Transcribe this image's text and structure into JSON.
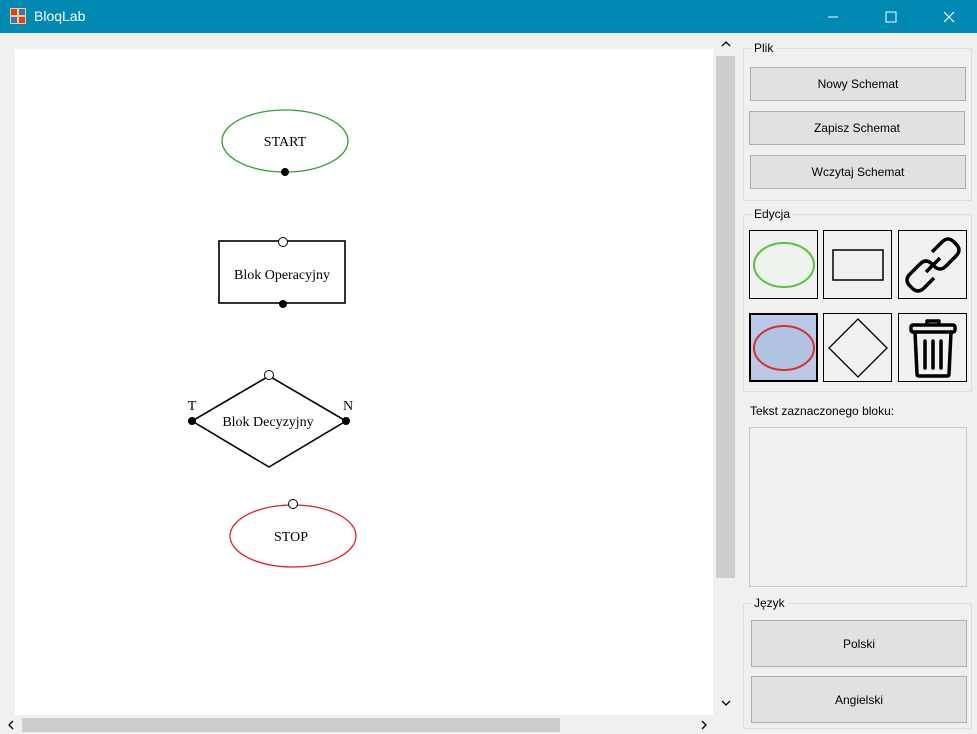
{
  "window": {
    "title": "BloqLab",
    "controls": [
      "minimize",
      "maximize",
      "close"
    ]
  },
  "diagram": {
    "blocks": [
      {
        "type": "start",
        "label": "START",
        "color": "#2e9e2e"
      },
      {
        "type": "operation",
        "label": "Blok Operacyjny",
        "color": "#000000"
      },
      {
        "type": "decision",
        "label": "Blok Decyzyjny",
        "true_label": "T",
        "false_label": "N",
        "color": "#000000"
      },
      {
        "type": "stop",
        "label": "STOP",
        "color": "#e02020"
      }
    ]
  },
  "panel": {
    "file_group": {
      "title": "Plik",
      "buttons": [
        "Nowy Schemat",
        "Zapisz Schemat",
        "Wczytaj Schemat"
      ]
    },
    "edit_group": {
      "title": "Edycja",
      "tools": [
        {
          "icon": "start-ellipse-icon",
          "selected": false
        },
        {
          "icon": "rectangle-icon",
          "selected": false
        },
        {
          "icon": "link-icon",
          "selected": false
        },
        {
          "icon": "stop-ellipse-icon",
          "selected": true
        },
        {
          "icon": "diamond-icon",
          "selected": false
        },
        {
          "icon": "trash-icon",
          "selected": false
        }
      ]
    },
    "selected_text": {
      "label": "Tekst zaznaczonego bloku:",
      "value": ""
    },
    "language_group": {
      "title": "Język",
      "buttons": [
        "Polski",
        "Angielski"
      ]
    }
  },
  "colors": {
    "titlebar": "#0089b3",
    "start": "#2e9e2e",
    "stop": "#e02020",
    "selected_tool": "#b9c9e6"
  }
}
